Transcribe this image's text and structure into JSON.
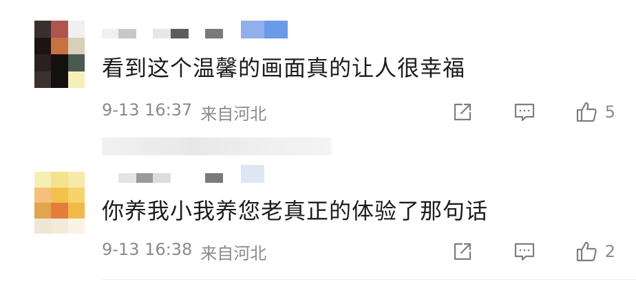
{
  "comments": [
    {
      "text": "看到这个温馨的画面真的让人很幸福",
      "date": "9-13 16:37",
      "location": "来自河北",
      "likes": "5",
      "avatar_colors": [
        "#3a2f2f",
        "#b0544d",
        "#f0f0f0",
        "#1c1414",
        "#c8733e",
        "#d9cfb8",
        "#2a2222",
        "#151010",
        "#4a5a50",
        "#3d3030",
        "#121010",
        "#f3f1b8"
      ],
      "username_blocks": [
        "#f0f0f0",
        "#c8c8c8",
        "#ffffff",
        "#e6e6e6",
        "#5c5c5c",
        "#ffffff",
        "#7a7a7a",
        "#ffffff",
        "#8fb0ea",
        "#6a9be8"
      ]
    },
    {
      "text": "你养我小我养您老真正的体验了那句话",
      "date": "9-13 16:38",
      "location": "来自河北",
      "likes": "2",
      "avatar_colors": [
        "#f6efb0",
        "#f4e28c",
        "#f7e9a8",
        "#f4c07a",
        "#f3c04a",
        "#f6d36c",
        "#e2a44e",
        "#e67c3a",
        "#f2b84a",
        "#f0e6d8",
        "#f4ead8",
        "#fbf3e4"
      ],
      "username_blocks": [
        "#ffffff",
        "#e4e4e4",
        "#9a9a9a",
        "#dcdcdc",
        "#ffffff",
        "#ffffff",
        "#7a7a7a",
        "#ffffff",
        "#dfe6f3"
      ]
    }
  ],
  "icons": {
    "share": "share-icon",
    "comment": "comment-icon",
    "like": "thumbs-up-icon"
  },
  "colors": {
    "text": "#1b1b1b",
    "meta": "#8a8a8a",
    "icon": "#7d7d7d"
  }
}
